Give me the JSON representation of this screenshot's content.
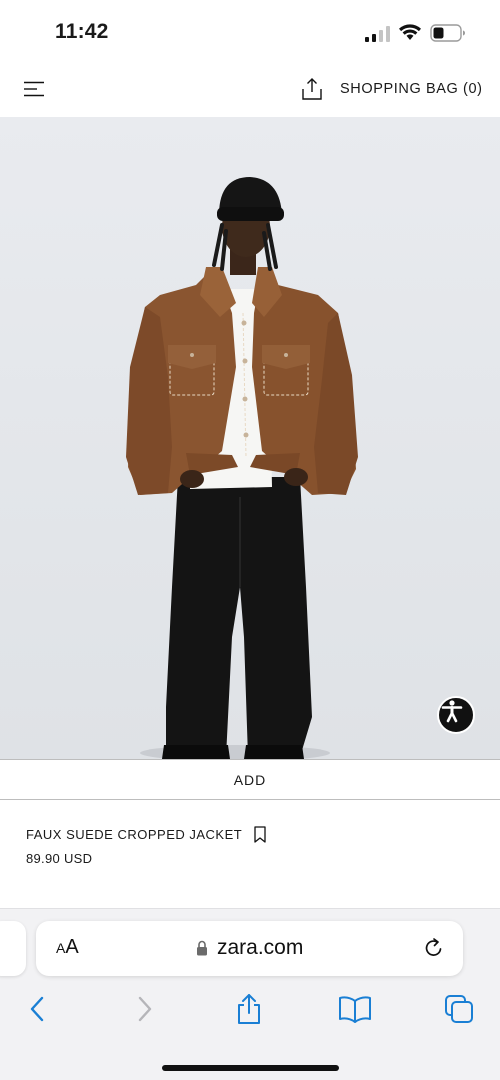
{
  "status_bar": {
    "time": "11:42"
  },
  "header": {
    "shopping_bag_label": "SHOPPING BAG (0)",
    "menu_icon": "hamburger-menu-icon",
    "share_icon": "share-icon"
  },
  "product": {
    "name": "FAUX SUEDE CROPPED JACKET",
    "price": "89.90 USD",
    "add_label": "ADD",
    "image_alt": "Model wearing brown faux suede cropped jacket with black beanie, white t-shirt and black wide trousers"
  },
  "browser": {
    "text_size_label_small": "A",
    "text_size_label_large": "A",
    "url": "zara.com",
    "accent_color": "#1a7fd4"
  },
  "colors": {
    "jacket": "#8a5530",
    "pants": "#141414",
    "background": "#e6e8ec"
  }
}
